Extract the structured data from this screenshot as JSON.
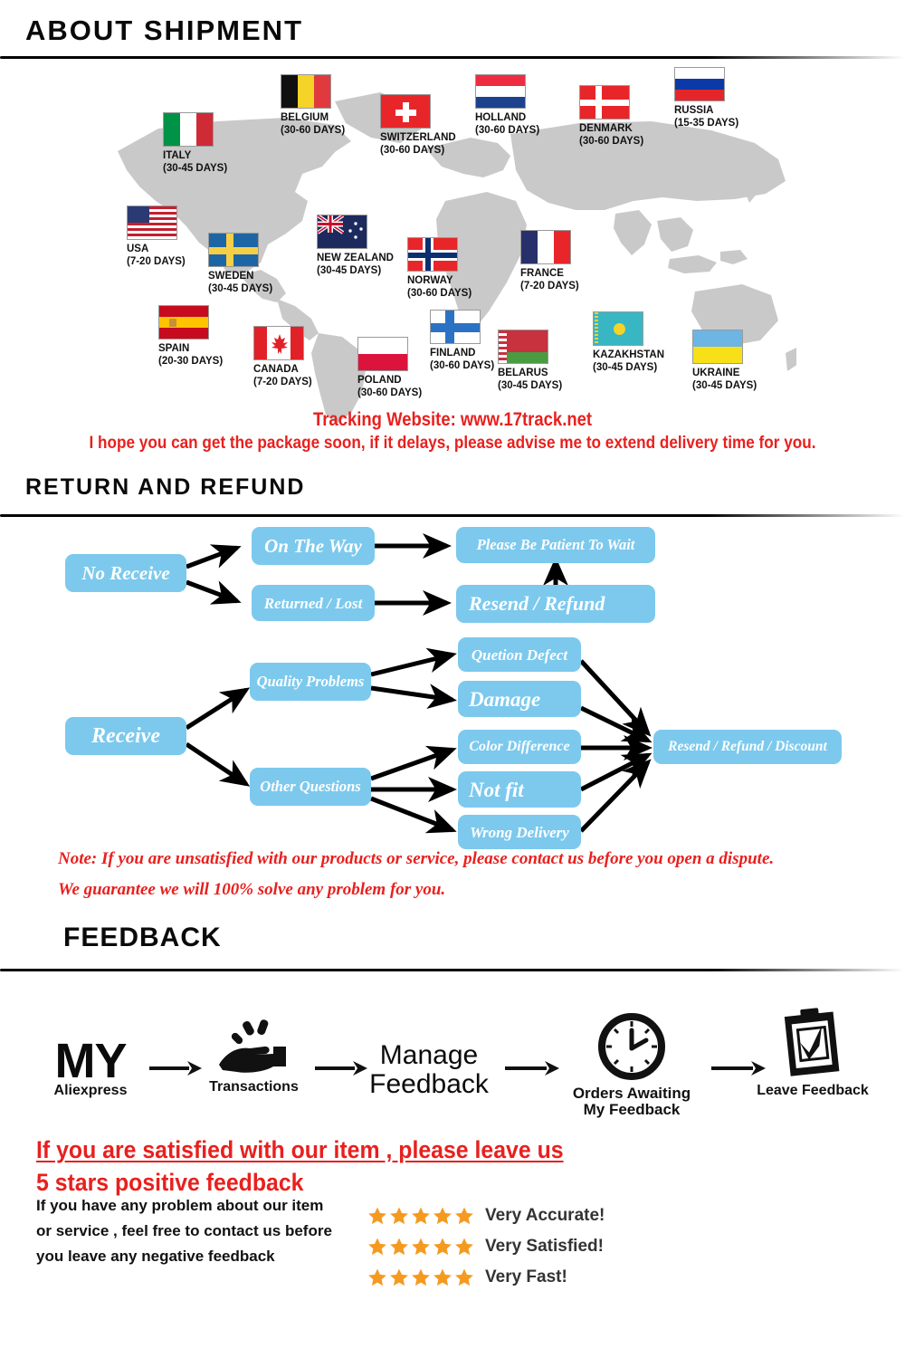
{
  "sections": {
    "shipment_title": "ABOUT  SHIPMENT",
    "return_title": "RETURN  AND  REFUND",
    "feedback_title": "FEEDBACK"
  },
  "shipment": {
    "tracking_line": "Tracking Website: www.17track.net",
    "hope_line": "I hope you can get the package soon, if it delays, please advise me to extend delivery time for you.",
    "map_color": "#C9C9C9",
    "countries": [
      {
        "name": "ITALY",
        "days": "(30-45 DAYS)",
        "flag": "italy"
      },
      {
        "name": "BELGIUM",
        "days": "(30-60 DAYS)",
        "flag": "belgium"
      },
      {
        "name": "SWITZERLAND",
        "days": "(30-60 DAYS)",
        "flag": "switzerland"
      },
      {
        "name": "HOLLAND",
        "days": "(30-60 DAYS)",
        "flag": "holland"
      },
      {
        "name": "DENMARK",
        "days": "(30-60 DAYS)",
        "flag": "denmark"
      },
      {
        "name": "RUSSIA",
        "days": "(15-35 DAYS)",
        "flag": "russia"
      },
      {
        "name": "USA",
        "days": "(7-20 DAYS)",
        "flag": "usa"
      },
      {
        "name": "SWEDEN",
        "days": "(30-45 DAYS)",
        "flag": "sweden"
      },
      {
        "name": "NEW ZEALAND",
        "days": "(30-45 DAYS)",
        "flag": "newzealand"
      },
      {
        "name": "NORWAY",
        "days": "(30-60 DAYS)",
        "flag": "norway"
      },
      {
        "name": "FRANCE",
        "days": "(7-20 DAYS)",
        "flag": "france"
      },
      {
        "name": "SPAIN",
        "days": "(20-30 DAYS)",
        "flag": "spain"
      },
      {
        "name": "CANADA",
        "days": "(7-20 DAYS)",
        "flag": "canada"
      },
      {
        "name": "POLAND",
        "days": "(30-60 DAYS)",
        "flag": "poland"
      },
      {
        "name": "FINLAND",
        "days": "(30-60 DAYS)",
        "flag": "finland"
      },
      {
        "name": "BELARUS",
        "days": "(30-45 DAYS)",
        "flag": "belarus"
      },
      {
        "name": "KAZAKHSTAN",
        "days": "(30-45 DAYS)",
        "flag": "kazakhstan"
      },
      {
        "name": "UKRAINE",
        "days": "(30-45 DAYS)",
        "flag": "ukraine"
      }
    ]
  },
  "flowchart": {
    "box_color": "#7CC9ED",
    "nodes": {
      "no_receive": "No Receive",
      "on_the_way": "On The Way",
      "returned_lost": "Returned / Lost",
      "please_wait": "Please Be Patient To Wait",
      "resend_refund": "Resend / Refund",
      "receive": "Receive",
      "quality_problems": "Quality Problems",
      "other_questions": "Other Questions",
      "quetion_defect": "Quetion Defect",
      "damage": "Damage",
      "color_difference": "Color Difference",
      "not_fit": "Not fit",
      "wrong_delivery": "Wrong Delivery",
      "resend_refund_discount": "Resend / Refund / Discount"
    },
    "note_line1": "Note: If you are unsatisfied with our products or service, please contact us before you open a dispute.",
    "note_line2": "We guarantee we will 100% solve any problem for you."
  },
  "feedback": {
    "steps": [
      {
        "big": "MY",
        "cap": "Aliexpress",
        "icon": "my-aliexpress-text"
      },
      {
        "big": "",
        "cap": "Transactions",
        "icon": "hand-coins-icon"
      },
      {
        "big": "Manage\nFeedback",
        "cap": "",
        "icon": "manage-feedback-text"
      },
      {
        "big": "",
        "cap": "Orders Awaiting\nMy Feedback",
        "icon": "clock-icon"
      },
      {
        "big": "",
        "cap": "Leave Feedback",
        "icon": "clipboard-check-icon"
      }
    ],
    "red_line1": "If you are satisfied with our item , please leave us",
    "red_line2": "5 stars positive feedback",
    "paragraph": "If you have any problem about our item or service , feel free to contact us before you  leave any negative feedback",
    "star_color": "#F59A20",
    "ratings": [
      {
        "stars": 5,
        "text": "Very Accurate!"
      },
      {
        "stars": 5,
        "text": "Very Satisfied!"
      },
      {
        "stars": 5,
        "text": "Very Fast!"
      }
    ]
  }
}
